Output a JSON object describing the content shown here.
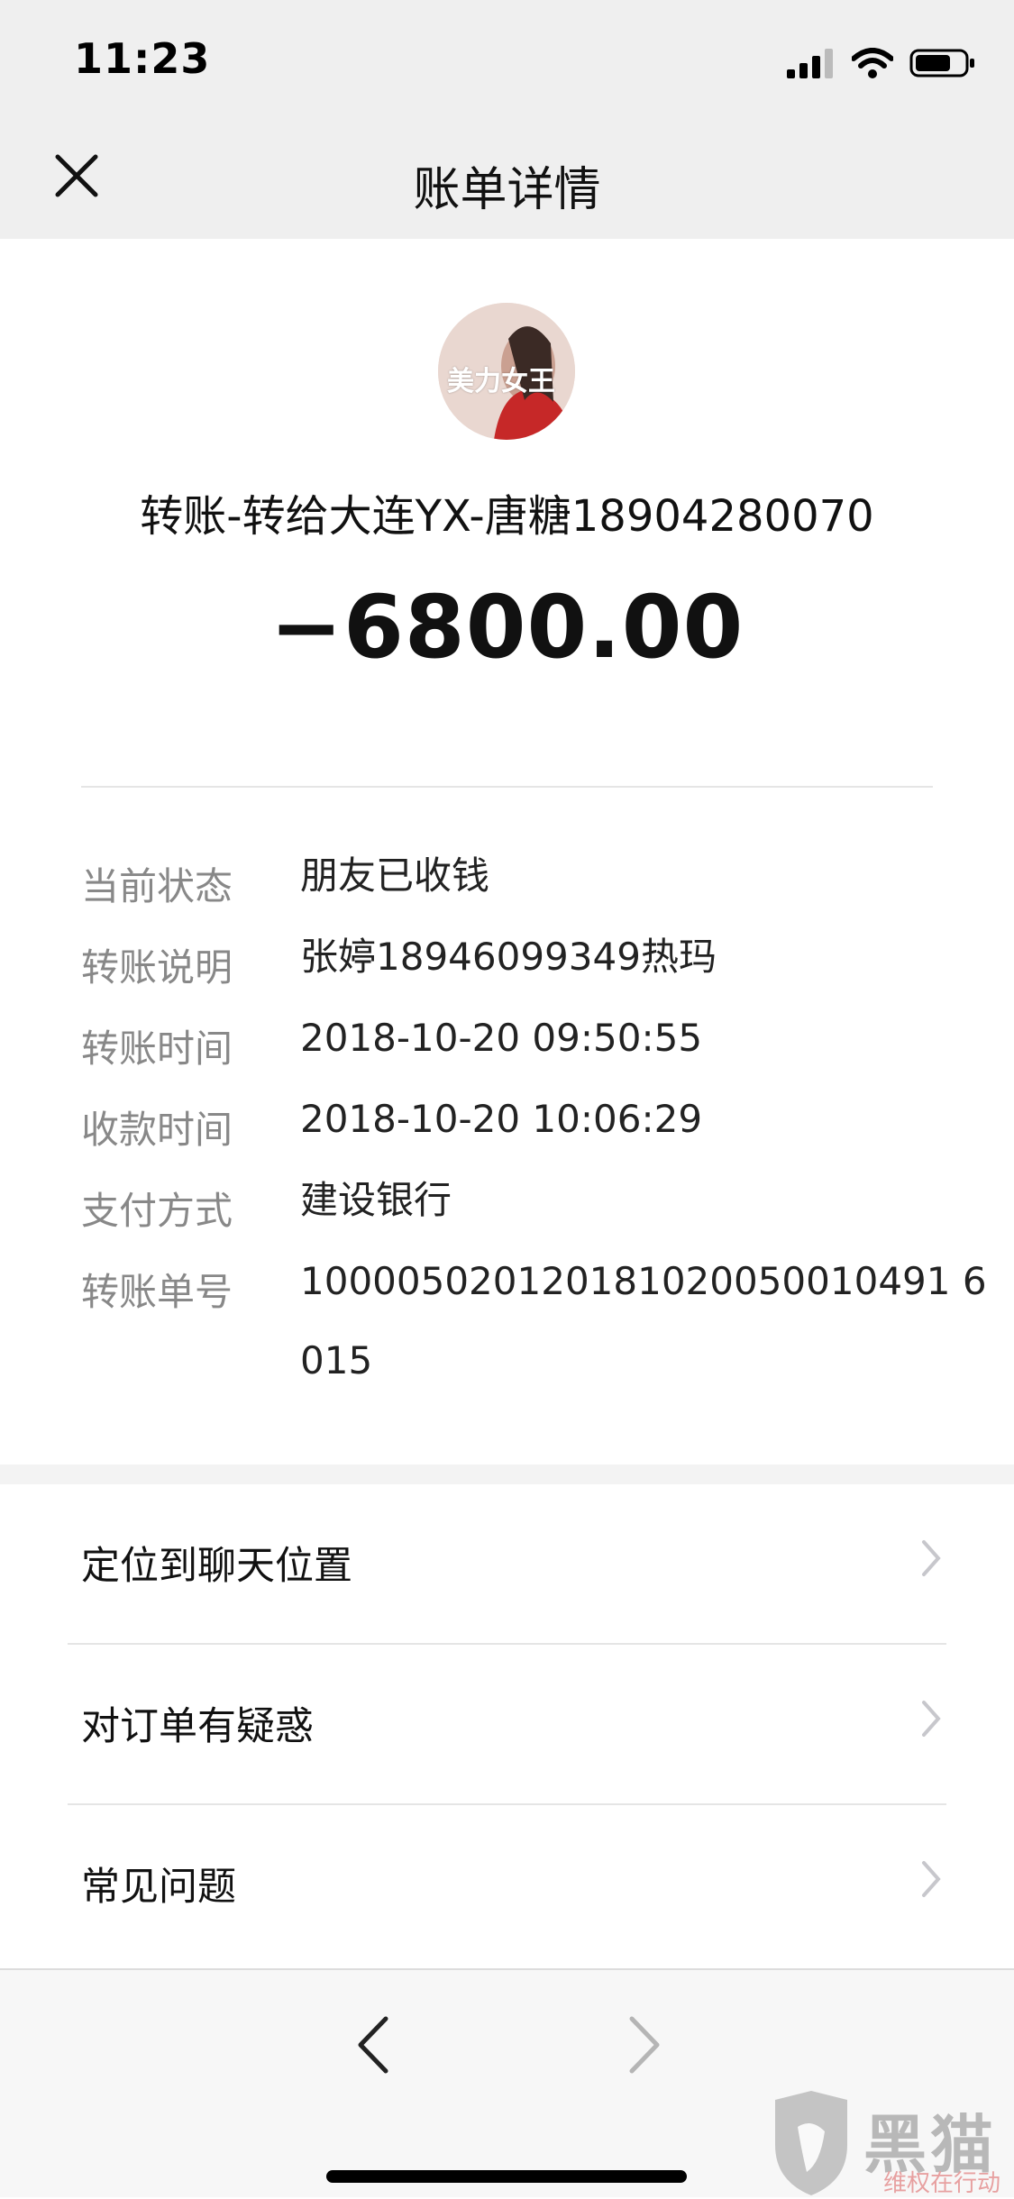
{
  "status_bar": {
    "time": "11:23"
  },
  "nav": {
    "title": "账单详情",
    "close_icon": "close-icon"
  },
  "transaction": {
    "avatar_text": "美力女王",
    "payee": "转账-转给大连YX-唐糖18904280070",
    "amount": "−6800.00"
  },
  "details": [
    {
      "label": "当前状态",
      "value": "朋友已收钱"
    },
    {
      "label": "转账说明",
      "value": "张婷18946099349热玛"
    },
    {
      "label": "转账时间",
      "value": "2018-10-20 09:50:55"
    },
    {
      "label": "收款时间",
      "value": "2018-10-20 10:06:29"
    },
    {
      "label": "支付方式",
      "value": "建设银行"
    },
    {
      "label": "转账单号",
      "value": "100005020120181020050010491 6015"
    }
  ],
  "menu": [
    {
      "label": "定位到聊天位置"
    },
    {
      "label": "对订单有疑惑"
    },
    {
      "label": "常见问题"
    }
  ],
  "watermark": {
    "main": "黑猫",
    "sub": "维权在行动"
  },
  "colors": {
    "nav_background": "#efefef",
    "label_gray": "#888888",
    "text_dark": "#111111"
  }
}
